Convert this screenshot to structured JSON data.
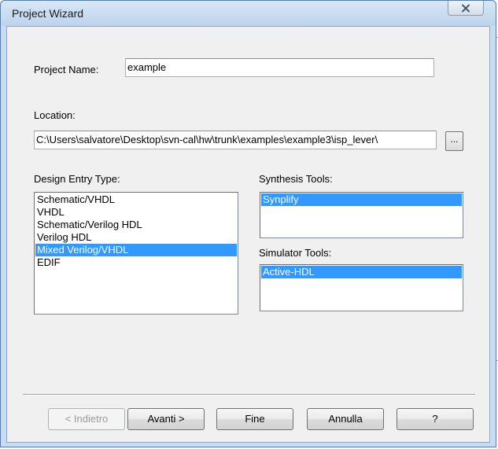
{
  "window": {
    "title": "Project Wizard"
  },
  "form": {
    "project_name_label": "Project Name:",
    "project_name_value": "example",
    "location_label": "Location:",
    "location_value": "C:\\Users\\salvatore\\Desktop\\svn-cal\\hw\\trunk\\examples\\example3\\isp_lever\\",
    "browse_label": "..."
  },
  "design_entry": {
    "label": "Design Entry Type:",
    "items": [
      "Schematic/VHDL",
      "VHDL",
      "Schematic/Verilog HDL",
      "Verilog HDL",
      "Mixed Verilog/VHDL",
      "EDIF"
    ],
    "selected": "Mixed Verilog/VHDL"
  },
  "synthesis": {
    "label": "Synthesis Tools:",
    "items": [
      "Synplify"
    ],
    "selected": "Synplify"
  },
  "simulator": {
    "label": "Simulator Tools:",
    "items": [
      "Active-HDL"
    ],
    "selected": "Active-HDL"
  },
  "buttons": {
    "back": "< Indietro",
    "next": "Avanti >",
    "finish": "Fine",
    "cancel": "Annulla",
    "help": "?"
  },
  "icons": {
    "close": "close-icon"
  },
  "colors": {
    "selection": "#3399ff",
    "titlebar": "#bdd3ec"
  }
}
